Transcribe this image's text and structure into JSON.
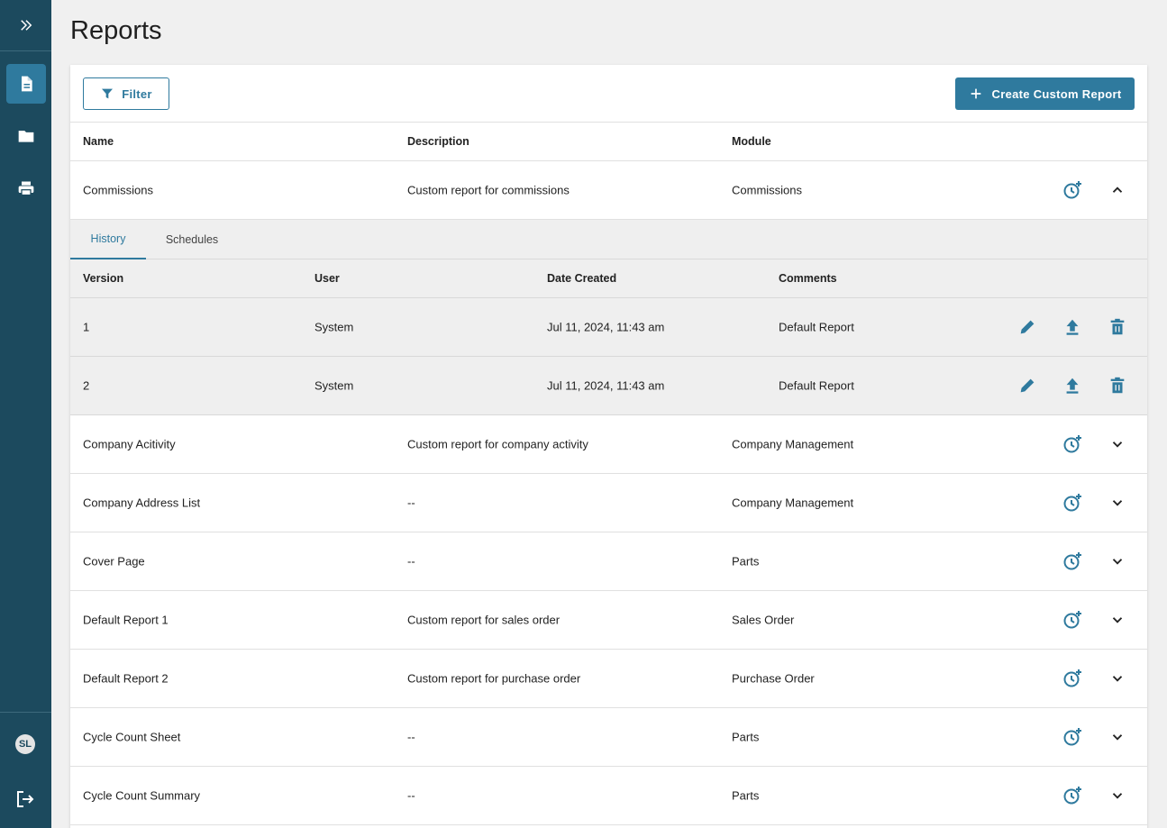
{
  "page": {
    "title": "Reports"
  },
  "sidebar": {
    "items": [
      {
        "icon": "document-icon",
        "active": true
      },
      {
        "icon": "folder-icon",
        "active": false
      },
      {
        "icon": "printer-icon",
        "active": false
      }
    ],
    "user_initials": "SL"
  },
  "toolbar": {
    "filter_label": "Filter",
    "create_label": "Create Custom Report"
  },
  "table": {
    "headers": {
      "name": "Name",
      "description": "Description",
      "module": "Module"
    },
    "rows": [
      {
        "name": "Commissions",
        "description": "Custom report for commissions",
        "module": "Commissions",
        "expanded": true
      },
      {
        "name": "Company Acitivity",
        "description": "Custom report for company activity",
        "module": "Company Management"
      },
      {
        "name": "Company Address List",
        "description": "--",
        "module": "Company Management"
      },
      {
        "name": "Cover Page",
        "description": "--",
        "module": "Parts"
      },
      {
        "name": "Default Report 1",
        "description": "Custom report for sales order",
        "module": "Sales Order"
      },
      {
        "name": "Default Report 2",
        "description": "Custom report for purchase order",
        "module": "Purchase Order"
      },
      {
        "name": "Cycle Count Sheet",
        "description": "--",
        "module": "Parts"
      },
      {
        "name": "Cycle Count Summary",
        "description": "--",
        "module": "Parts"
      }
    ]
  },
  "expanded": {
    "tabs": [
      "History",
      "Schedules"
    ],
    "active_tab": "History",
    "headers": {
      "version": "Version",
      "user": "User",
      "date": "Date Created",
      "comments": "Comments"
    },
    "rows": [
      {
        "version": "1",
        "user": "System",
        "date": "Jul 11, 2024, 11:43 am",
        "comments": "Default Report"
      },
      {
        "version": "2",
        "user": "System",
        "date": "Jul 11, 2024, 11:43 am",
        "comments": "Default Report"
      }
    ]
  },
  "colors": {
    "sidebar": "#1c4a5e",
    "accent": "#2f7a9e"
  }
}
